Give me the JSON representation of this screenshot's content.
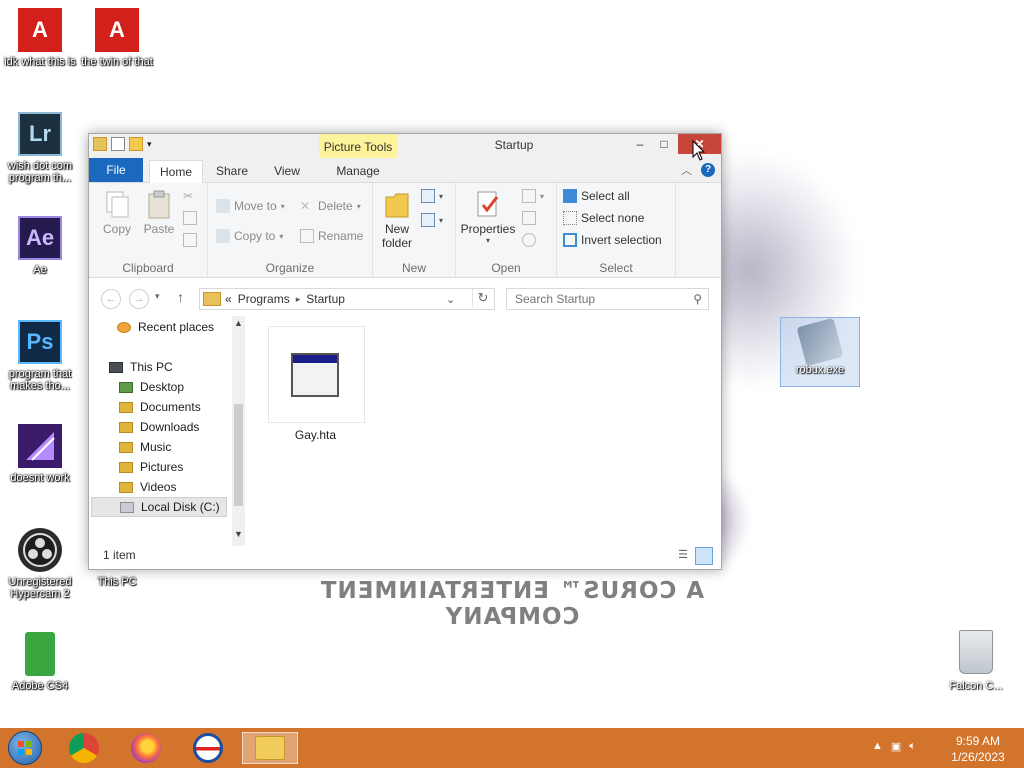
{
  "desktop": {
    "icons_left": [
      {
        "label": "idk what this is",
        "icon": "adobe-reader-icon",
        "glyph": "A"
      },
      {
        "label": "the twin of that",
        "icon": "adobe-reader-icon",
        "glyph": "A"
      },
      {
        "label": "wish dot com program th...",
        "icon": "lightroom-icon",
        "glyph": "Lr"
      },
      {
        "label": "Ae",
        "icon": "after-effects-icon",
        "glyph": "Ae"
      },
      {
        "label": "program that makes tho...",
        "icon": "photoshop-icon",
        "glyph": "Ps"
      },
      {
        "label": "doesnt work",
        "icon": "premiere-icon",
        "glyph": ""
      },
      {
        "label": "Unregistered Hypercam 2",
        "icon": "obs-icon",
        "glyph": ""
      },
      {
        "label": "This PC",
        "icon": "computer-icon",
        "glyph": ""
      },
      {
        "label": "Adobe CS4",
        "icon": "green-file-icon",
        "glyph": ""
      }
    ],
    "robux": {
      "label": "robux.exe",
      "icon": "exe-shortcut-icon"
    },
    "recycle_bin": {
      "label": "Falcon C...",
      "icon": "recycle-bin-icon"
    },
    "wallpaper_text": "A CORUS™ ENTERTAINMENT COMPANY"
  },
  "window": {
    "title": "Startup",
    "context_tab": "Picture Tools",
    "controls": {
      "minimize": "–",
      "maximize": "□",
      "close": "✕"
    },
    "tabs": {
      "file": "File",
      "home": "Home",
      "share": "Share",
      "view": "View",
      "manage": "Manage"
    },
    "help": "?",
    "ribbon": {
      "clipboard": {
        "label": "Clipboard",
        "copy": "Copy",
        "paste": "Paste"
      },
      "organize": {
        "label": "Organize",
        "move_to": "Move to",
        "copy_to": "Copy to",
        "delete": "Delete",
        "rename": "Rename"
      },
      "new": {
        "label": "New",
        "new_folder": "New folder"
      },
      "open": {
        "label": "Open",
        "properties": "Properties"
      },
      "select": {
        "label": "Select",
        "select_all": "Select all",
        "select_none": "Select none",
        "invert": "Invert selection"
      }
    },
    "address": {
      "breadcrumb_prefix": "«",
      "crumbs": [
        "Programs",
        "Startup"
      ],
      "separator": "▸"
    },
    "search": {
      "placeholder": "Search Startup"
    },
    "nav": [
      {
        "label": "Recent places",
        "indent": 1
      },
      {
        "label": "This PC",
        "indent": 0
      },
      {
        "label": "Desktop",
        "indent": 1
      },
      {
        "label": "Documents",
        "indent": 1
      },
      {
        "label": "Downloads",
        "indent": 1
      },
      {
        "label": "Music",
        "indent": 1
      },
      {
        "label": "Pictures",
        "indent": 1
      },
      {
        "label": "Videos",
        "indent": 1
      },
      {
        "label": "Local Disk (C:)",
        "indent": 1
      }
    ],
    "files": [
      {
        "name": "Gay.hta",
        "icon": "hta-application-icon"
      }
    ],
    "status": "1 item"
  },
  "taskbar": {
    "clock_time": "9:59 AM",
    "clock_date": "1/26/2023"
  }
}
